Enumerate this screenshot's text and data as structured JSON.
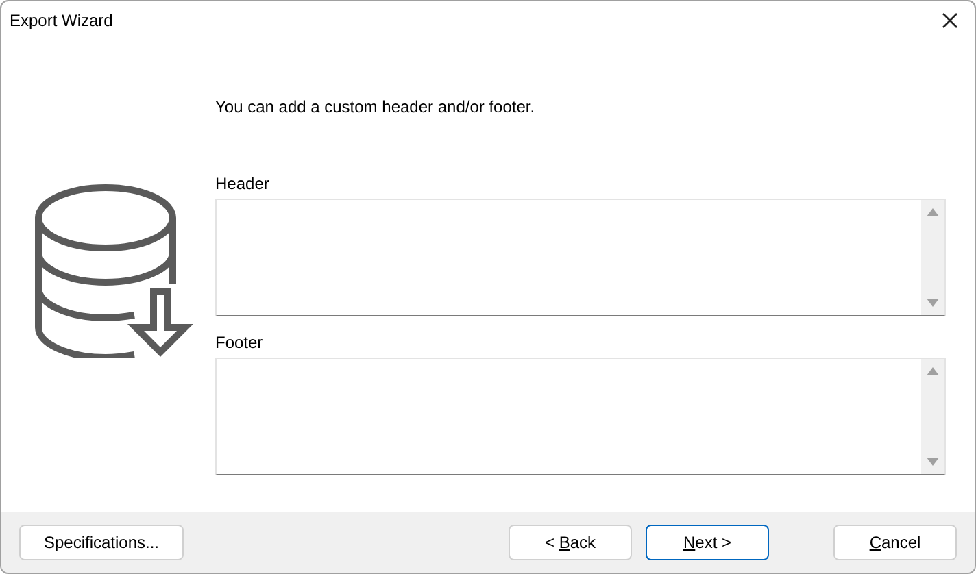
{
  "window": {
    "title": "Export Wizard"
  },
  "instruction": "You can add a custom header and/or footer.",
  "fields": [
    {
      "label": "Header"
    },
    {
      "label": "Footer"
    }
  ],
  "buttons": [
    {
      "label": "Specifications...",
      "default": false
    },
    {
      "before": "< ",
      "key": "B",
      "after": "ack",
      "default": false
    },
    {
      "key": "N",
      "after": "ext >",
      "default": true
    },
    {
      "key": "C",
      "after": "ancel",
      "default": false
    }
  ]
}
